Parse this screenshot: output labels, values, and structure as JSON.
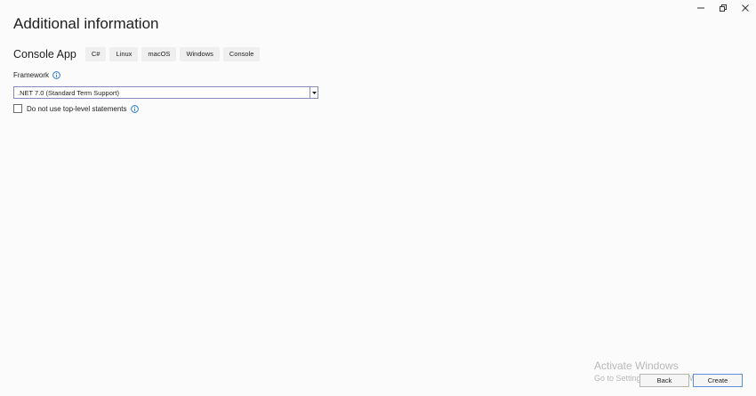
{
  "header": {
    "title": "Additional information"
  },
  "template": {
    "name": "Console App",
    "tags": [
      "C#",
      "Linux",
      "macOS",
      "Windows",
      "Console"
    ]
  },
  "framework": {
    "label": "Framework",
    "selected": ".NET 7.0 (Standard Term Support)"
  },
  "options": {
    "top_level_label": "Do not use top-level statements",
    "top_level_checked": false
  },
  "watermark": {
    "title": "Activate Windows",
    "subtitle": "Go to Settings to activate Windows."
  },
  "footer": {
    "back_label": "Back",
    "create_label": "Create"
  },
  "colors": {
    "accent": "#5a8fd8",
    "info_icon": "#1a6fc4",
    "select_border": "#8a8ab8"
  },
  "icons": [
    "minimize-icon",
    "restore-icon",
    "close-icon",
    "info-icon",
    "chevron-down-icon"
  ]
}
